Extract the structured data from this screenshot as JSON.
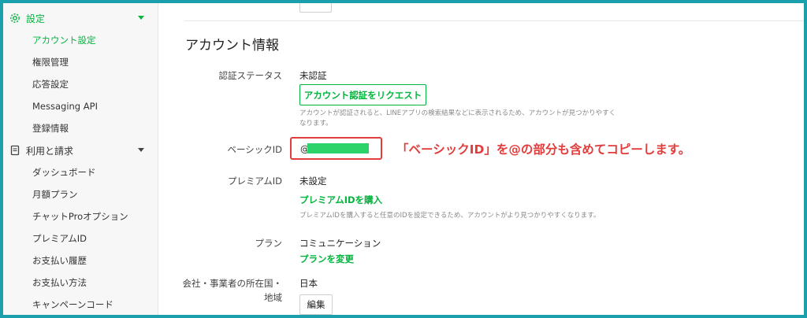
{
  "sidebar": {
    "settings": {
      "label": "設定"
    },
    "settings_items": [
      {
        "label": "アカウント設定"
      },
      {
        "label": "権限管理"
      },
      {
        "label": "応答設定"
      },
      {
        "label": "Messaging API"
      },
      {
        "label": "登録情報"
      }
    ],
    "billing": {
      "label": "利用と請求"
    },
    "billing_items": [
      {
        "label": "ダッシュボード"
      },
      {
        "label": "月額プラン"
      },
      {
        "label": "チャットProオプション"
      },
      {
        "label": "プレミアムID"
      },
      {
        "label": "お支払い履歴"
      },
      {
        "label": "お支払い方法"
      },
      {
        "label": "キャンペーンコード"
      }
    ]
  },
  "main": {
    "section_title": "アカウント情報",
    "verification": {
      "label": "認証ステータス",
      "value": "未認証",
      "request_button": "アカウント認証をリクエスト",
      "note_line1": "アカウントが認証されると、LINEアプリの検索結果などに表示されるため、アカウントが見つかりやすく",
      "note_line2": "なります。"
    },
    "basic_id": {
      "label": "ベーシックID",
      "prefix": "@"
    },
    "annotation": "「ベーシックID」を@の部分も含めてコピーします。",
    "premium_id": {
      "label": "プレミアムID",
      "value": "未設定",
      "link": "プレミアムIDを購入",
      "note": "プレミアムIDを購入すると任意のIDを設定できるため、アカウントがより見つかりやすくなります。"
    },
    "plan": {
      "label": "プラン",
      "value": "コミュニケーション",
      "link": "プランを変更"
    },
    "country": {
      "label_line1": "会社・事業者の所在国・",
      "label_line2": "地域",
      "value": "日本",
      "edit_button": "編集"
    }
  },
  "colors": {
    "accent": "#06b33f",
    "highlight": "#e23d3d",
    "frame": "#1aa0ad"
  }
}
